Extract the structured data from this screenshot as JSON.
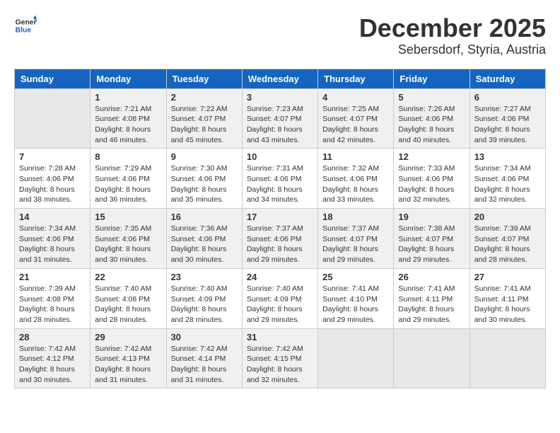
{
  "logo": {
    "general": "General",
    "blue": "Blue"
  },
  "title": "December 2025",
  "location": "Sebersdorf, Styria, Austria",
  "days_of_week": [
    "Sunday",
    "Monday",
    "Tuesday",
    "Wednesday",
    "Thursday",
    "Friday",
    "Saturday"
  ],
  "weeks": [
    [
      {
        "day": "",
        "info": ""
      },
      {
        "day": "1",
        "info": "Sunrise: 7:21 AM\nSunset: 4:08 PM\nDaylight: 8 hours\nand 46 minutes."
      },
      {
        "day": "2",
        "info": "Sunrise: 7:22 AM\nSunset: 4:07 PM\nDaylight: 8 hours\nand 45 minutes."
      },
      {
        "day": "3",
        "info": "Sunrise: 7:23 AM\nSunset: 4:07 PM\nDaylight: 8 hours\nand 43 minutes."
      },
      {
        "day": "4",
        "info": "Sunrise: 7:25 AM\nSunset: 4:07 PM\nDaylight: 8 hours\nand 42 minutes."
      },
      {
        "day": "5",
        "info": "Sunrise: 7:26 AM\nSunset: 4:06 PM\nDaylight: 8 hours\nand 40 minutes."
      },
      {
        "day": "6",
        "info": "Sunrise: 7:27 AM\nSunset: 4:06 PM\nDaylight: 8 hours\nand 39 minutes."
      }
    ],
    [
      {
        "day": "7",
        "info": "Sunrise: 7:28 AM\nSunset: 4:06 PM\nDaylight: 8 hours\nand 38 minutes."
      },
      {
        "day": "8",
        "info": "Sunrise: 7:29 AM\nSunset: 4:06 PM\nDaylight: 8 hours\nand 36 minutes."
      },
      {
        "day": "9",
        "info": "Sunrise: 7:30 AM\nSunset: 4:06 PM\nDaylight: 8 hours\nand 35 minutes."
      },
      {
        "day": "10",
        "info": "Sunrise: 7:31 AM\nSunset: 4:06 PM\nDaylight: 8 hours\nand 34 minutes."
      },
      {
        "day": "11",
        "info": "Sunrise: 7:32 AM\nSunset: 4:06 PM\nDaylight: 8 hours\nand 33 minutes."
      },
      {
        "day": "12",
        "info": "Sunrise: 7:33 AM\nSunset: 4:06 PM\nDaylight: 8 hours\nand 32 minutes."
      },
      {
        "day": "13",
        "info": "Sunrise: 7:34 AM\nSunset: 4:06 PM\nDaylight: 8 hours\nand 32 minutes."
      }
    ],
    [
      {
        "day": "14",
        "info": "Sunrise: 7:34 AM\nSunset: 4:06 PM\nDaylight: 8 hours\nand 31 minutes."
      },
      {
        "day": "15",
        "info": "Sunrise: 7:35 AM\nSunset: 4:06 PM\nDaylight: 8 hours\nand 30 minutes."
      },
      {
        "day": "16",
        "info": "Sunrise: 7:36 AM\nSunset: 4:06 PM\nDaylight: 8 hours\nand 30 minutes."
      },
      {
        "day": "17",
        "info": "Sunrise: 7:37 AM\nSunset: 4:06 PM\nDaylight: 8 hours\nand 29 minutes."
      },
      {
        "day": "18",
        "info": "Sunrise: 7:37 AM\nSunset: 4:07 PM\nDaylight: 8 hours\nand 29 minutes."
      },
      {
        "day": "19",
        "info": "Sunrise: 7:38 AM\nSunset: 4:07 PM\nDaylight: 8 hours\nand 29 minutes."
      },
      {
        "day": "20",
        "info": "Sunrise: 7:39 AM\nSunset: 4:07 PM\nDaylight: 8 hours\nand 28 minutes."
      }
    ],
    [
      {
        "day": "21",
        "info": "Sunrise: 7:39 AM\nSunset: 4:08 PM\nDaylight: 8 hours\nand 28 minutes."
      },
      {
        "day": "22",
        "info": "Sunrise: 7:40 AM\nSunset: 4:08 PM\nDaylight: 8 hours\nand 28 minutes."
      },
      {
        "day": "23",
        "info": "Sunrise: 7:40 AM\nSunset: 4:09 PM\nDaylight: 8 hours\nand 28 minutes."
      },
      {
        "day": "24",
        "info": "Sunrise: 7:40 AM\nSunset: 4:09 PM\nDaylight: 8 hours\nand 29 minutes."
      },
      {
        "day": "25",
        "info": "Sunrise: 7:41 AM\nSunset: 4:10 PM\nDaylight: 8 hours\nand 29 minutes."
      },
      {
        "day": "26",
        "info": "Sunrise: 7:41 AM\nSunset: 4:11 PM\nDaylight: 8 hours\nand 29 minutes."
      },
      {
        "day": "27",
        "info": "Sunrise: 7:41 AM\nSunset: 4:11 PM\nDaylight: 8 hours\nand 30 minutes."
      }
    ],
    [
      {
        "day": "28",
        "info": "Sunrise: 7:42 AM\nSunset: 4:12 PM\nDaylight: 8 hours\nand 30 minutes."
      },
      {
        "day": "29",
        "info": "Sunrise: 7:42 AM\nSunset: 4:13 PM\nDaylight: 8 hours\nand 31 minutes."
      },
      {
        "day": "30",
        "info": "Sunrise: 7:42 AM\nSunset: 4:14 PM\nDaylight: 8 hours\nand 31 minutes."
      },
      {
        "day": "31",
        "info": "Sunrise: 7:42 AM\nSunset: 4:15 PM\nDaylight: 8 hours\nand 32 minutes."
      },
      {
        "day": "",
        "info": ""
      },
      {
        "day": "",
        "info": ""
      },
      {
        "day": "",
        "info": ""
      }
    ]
  ]
}
